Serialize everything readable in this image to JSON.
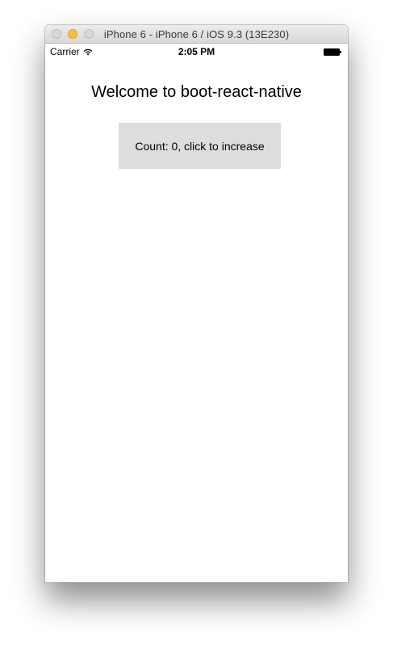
{
  "window": {
    "title": "iPhone 6 - iPhone 6 / iOS 9.3 (13E230)"
  },
  "statusbar": {
    "carrier": "Carrier",
    "time": "2:05 PM",
    "icons": [
      "wifi-icon",
      "battery-icon"
    ]
  },
  "app": {
    "welcome_text": "Welcome to boot-react-native",
    "counter_button_label": "Count: 0, click to increase"
  },
  "colors": {
    "minimize_light": "#fdbc40",
    "button_background": "#dddddd"
  }
}
